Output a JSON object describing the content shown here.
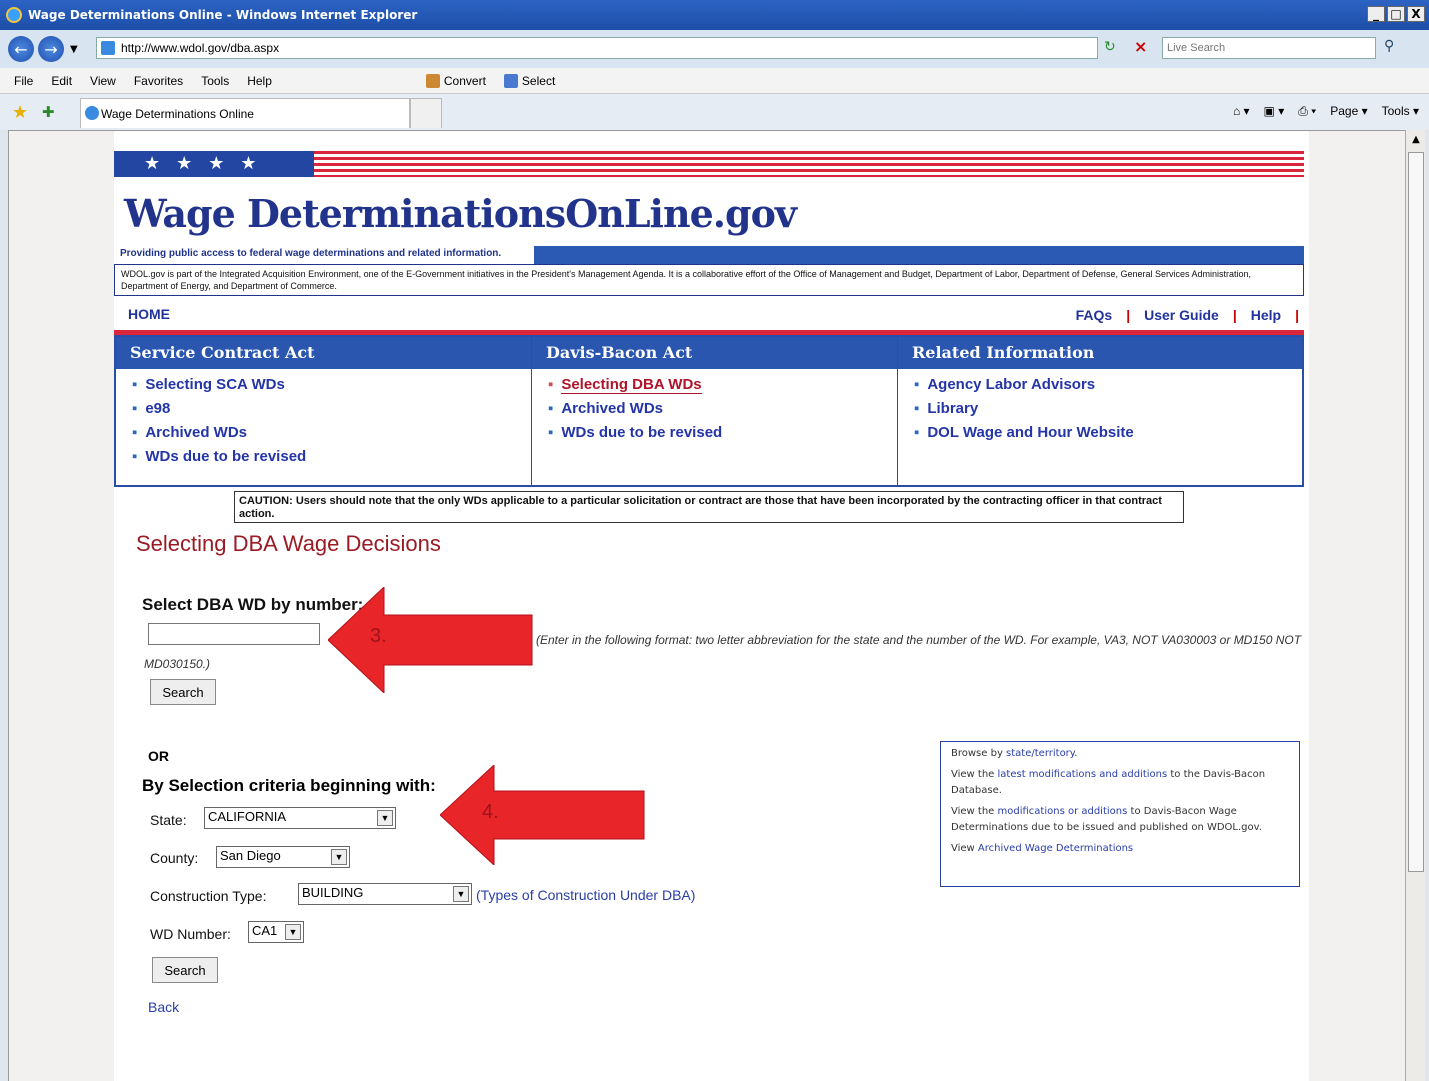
{
  "window": {
    "title": "Wage Determinations Online - Windows Internet Explorer",
    "controls": [
      "_",
      "□",
      "X"
    ]
  },
  "browser": {
    "url": "http://www.wdol.gov/dba.aspx",
    "search_placeholder": "Live Search",
    "menu": [
      "File",
      "Edit",
      "View",
      "Favorites",
      "Tools",
      "Help"
    ],
    "toolbar": {
      "convert": "Convert",
      "select": "Select"
    },
    "tab_title": "Wage Determinations Online",
    "command_bar": {
      "page": "Page",
      "tools": "Tools"
    }
  },
  "header": {
    "logo": "Wage DeterminationsOnLine.gov",
    "tagline": "Providing public access to federal wage determinations and related information.",
    "info": "WDOL.gov is part of the Integrated Acquisition Environment, one of the E-Government initiatives in the President's Management Agenda. It is a collaborative effort of the Office of Management and Budget, Department of Labor, Department of Defense, General Services Administration, Department of Energy, and Department of Commerce.",
    "home": "HOME",
    "links": {
      "faqs": "FAQs",
      "user_guide": "User Guide",
      "help": "Help"
    },
    "sep": "|"
  },
  "nav": {
    "sca": {
      "heading": "Service Contract Act",
      "items": [
        "Selecting SCA WDs",
        "e98",
        "Archived WDs",
        "WDs due to be revised"
      ]
    },
    "dba": {
      "heading": "Davis-Bacon Act",
      "items": [
        "Selecting DBA WDs",
        "Archived WDs",
        "WDs due to be revised"
      ]
    },
    "related": {
      "heading": "Related Information",
      "items": [
        "Agency Labor Advisors",
        "Library",
        "DOL Wage and Hour Website"
      ]
    }
  },
  "caution": "CAUTION: Users should note that the only WDs applicable to a particular solicitation or contract are those that have been incorporated by the contracting officer in that contract action.",
  "main": {
    "title": "Selecting DBA Wage Decisions",
    "by_number": {
      "label": "Select DBA WD by number:",
      "hint": "(Enter in the following format: two letter abbreviation for the state and the number of the WD. For example, VA3, NOT VA030003 or MD150 NOT MD030150.)",
      "search": "Search"
    },
    "or": "OR",
    "by_criteria": {
      "label": "By Selection criteria beginning with:",
      "state_label": "State:",
      "state_value": "CALIFORNIA",
      "county_label": "County:",
      "county_value": "San Diego",
      "construction_label": "Construction Type:",
      "construction_value": "BUILDING",
      "types_link": "(Types of Construction Under DBA)",
      "wd_number_label": "WD Number:",
      "wd_number_value": "CA1",
      "search": "Search"
    },
    "back": "Back"
  },
  "browse": {
    "p1_pre": "Browse by ",
    "p1_link": "state/territory",
    "p1_post": ".",
    "p2_pre": "View the ",
    "p2_link": "latest modifications and additions",
    "p2_post": " to the Davis-Bacon Database.",
    "p3_pre": "View the ",
    "p3_link": "modifications or additions",
    "p3_post": " to Davis-Bacon Wage Determinations due to be issued and published on WDOL.gov.",
    "p4_pre": "View ",
    "p4_link": "Archived Wage Determinations"
  },
  "annotations": {
    "step3": "3.",
    "step4": "4."
  },
  "colors": {
    "accent_red": "#e8262a",
    "link_blue": "#2435a8",
    "header_blue": "#2a56b0"
  }
}
